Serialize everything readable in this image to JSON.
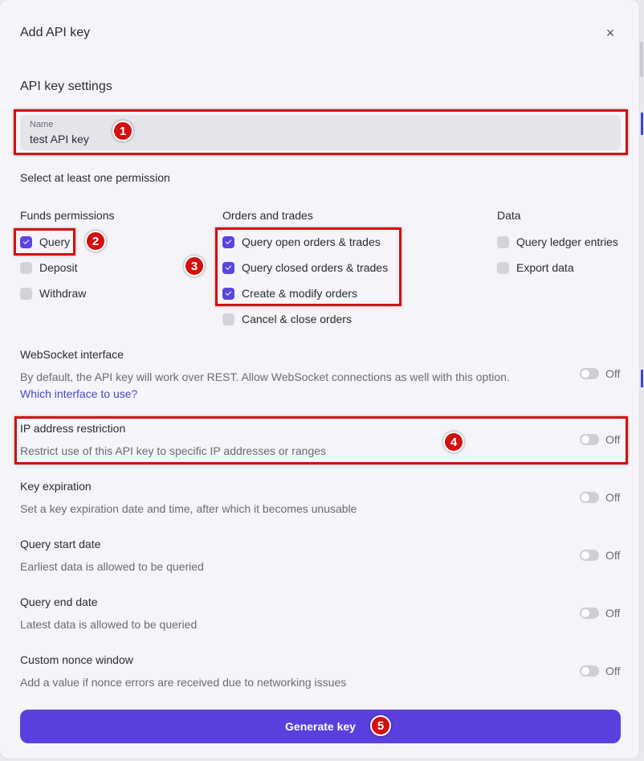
{
  "dialog": {
    "title": "Add API key",
    "close_icon": "close-icon"
  },
  "settings": {
    "title": "API key settings"
  },
  "name_field": {
    "label": "Name",
    "value": "test API key"
  },
  "permissions_hint": "Select at least one permission",
  "funds": {
    "title": "Funds permissions",
    "items": [
      {
        "label": "Query",
        "checked": true
      },
      {
        "label": "Deposit",
        "checked": false
      },
      {
        "label": "Withdraw",
        "checked": false
      }
    ]
  },
  "orders": {
    "title": "Orders and trades",
    "items": [
      {
        "label": "Query open orders & trades",
        "checked": true
      },
      {
        "label": "Query closed orders & trades",
        "checked": true
      },
      {
        "label": "Create & modify orders",
        "checked": true
      },
      {
        "label": "Cancel & close orders",
        "checked": false
      }
    ]
  },
  "data_perms": {
    "title": "Data",
    "items": [
      {
        "label": "Query ledger entries",
        "checked": false
      },
      {
        "label": "Export data",
        "checked": false
      }
    ]
  },
  "options": [
    {
      "title": "WebSocket interface",
      "description": "By default, the API key will work over REST. Allow WebSocket connections as well with this option.",
      "link": "Which interface to use?",
      "state": "Off"
    },
    {
      "title": "IP address restriction",
      "description": "Restrict use of this API key to specific IP addresses or ranges",
      "state": "Off"
    },
    {
      "title": "Key expiration",
      "description": "Set a key expiration date and time, after which it becomes unusable",
      "state": "Off"
    },
    {
      "title": "Query start date",
      "description": "Earliest data is allowed to be queried",
      "state": "Off"
    },
    {
      "title": "Query end date",
      "description": "Latest data is allowed to be queried",
      "state": "Off"
    },
    {
      "title": "Custom nonce window",
      "description": "Add a value if nonce errors are received due to networking issues",
      "state": "Off"
    }
  ],
  "generate_button": {
    "label": "Generate key"
  },
  "annotations": [
    "1",
    "2",
    "3",
    "4",
    "5"
  ],
  "colors": {
    "accent": "#5a3fde",
    "highlight": "#d31010",
    "checkbox_on": "#5b45e0",
    "link": "#4a47c9"
  }
}
